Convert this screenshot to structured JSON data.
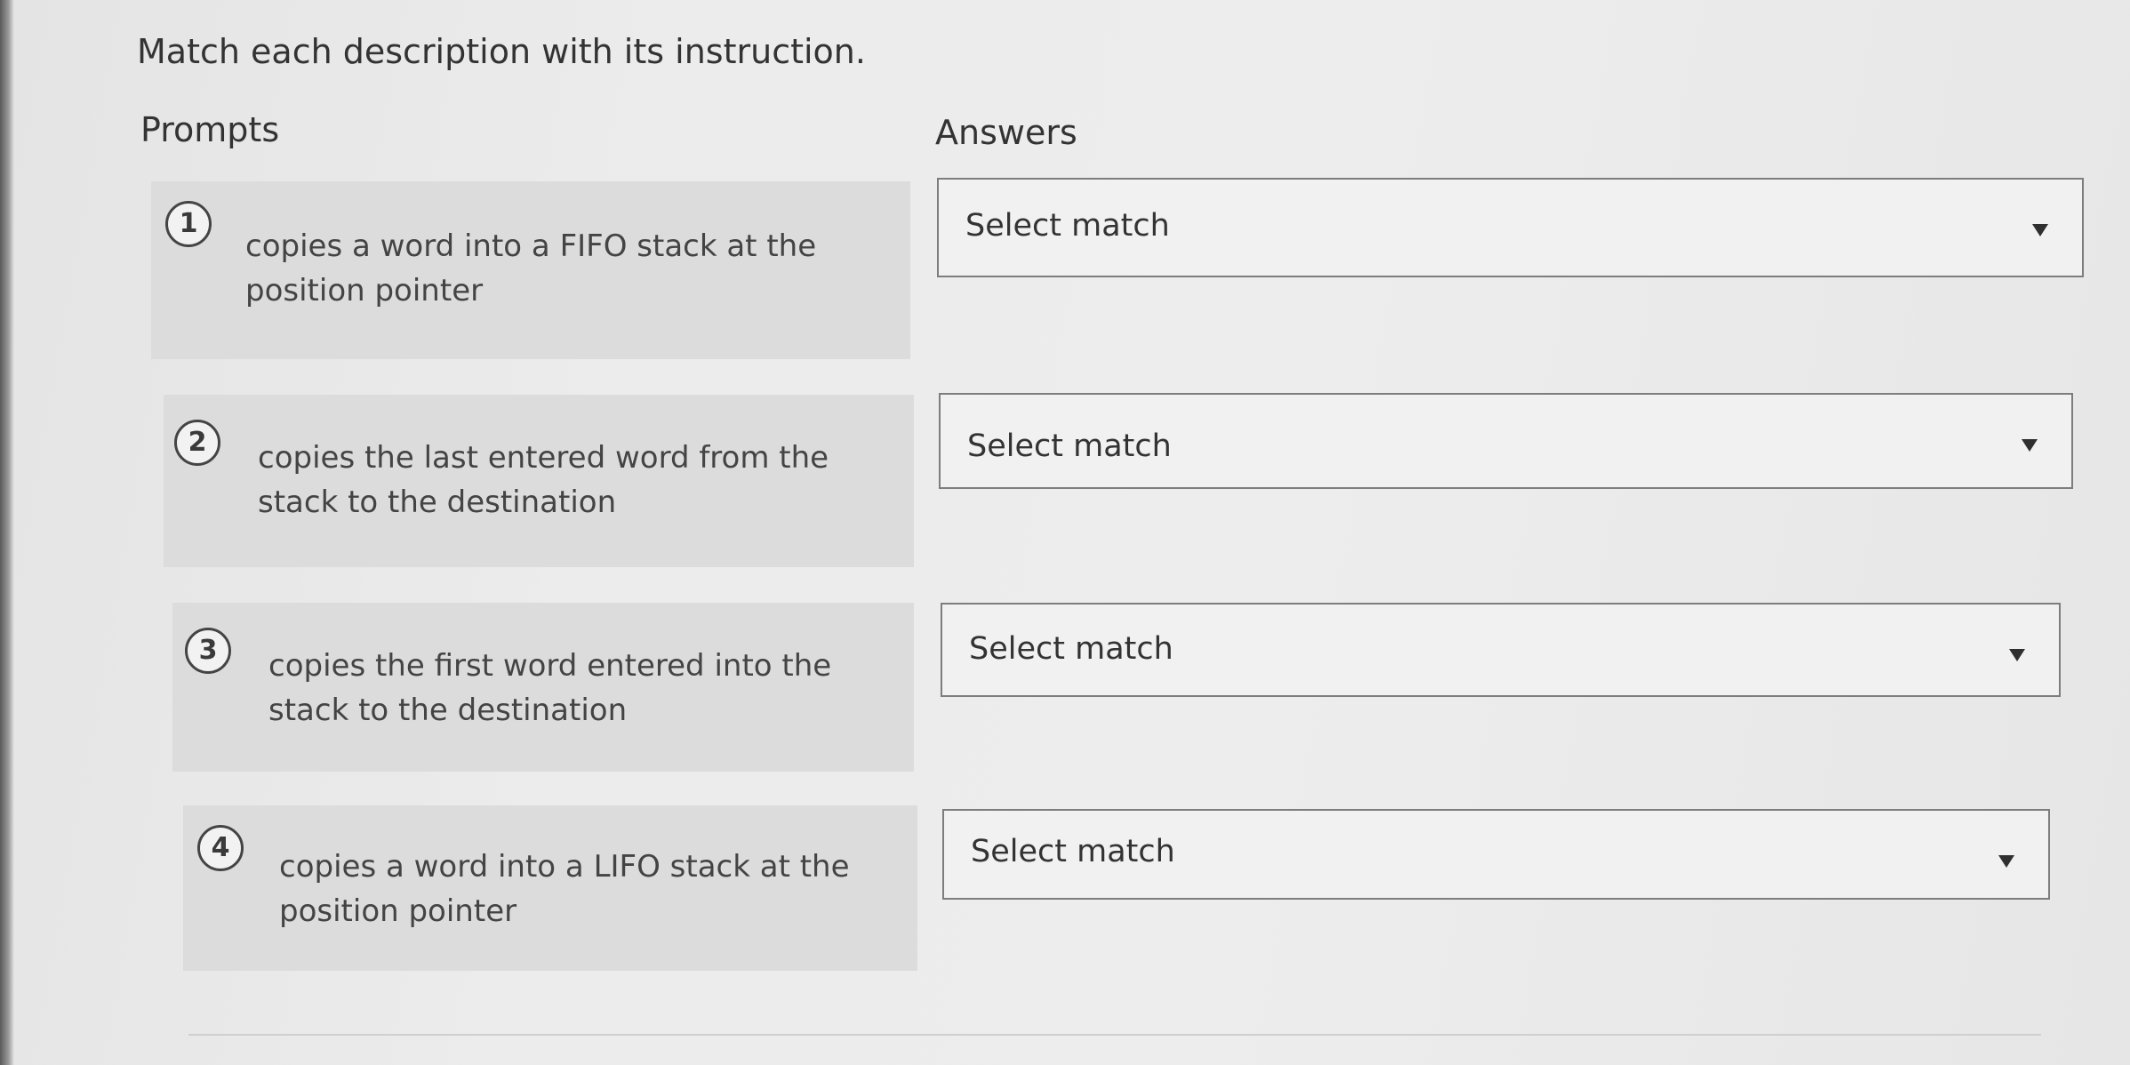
{
  "instruction": "Match each description with its instruction.",
  "columns": {
    "prompts_label": "Prompts",
    "answers_label": "Answers"
  },
  "prompts": [
    {
      "number": "1",
      "text": "copies a word into a FIFO stack at the position pointer"
    },
    {
      "number": "2",
      "text": "copies the last entered word from the stack to the destination"
    },
    {
      "number": "3",
      "text": "copies the first word entered into the stack to the destination"
    },
    {
      "number": "4",
      "text": "copies a word into a LIFO stack at the position pointer"
    }
  ],
  "answers": [
    {
      "selected": "Select match",
      "icon": "caret-down-icon"
    },
    {
      "selected": "Select match",
      "icon": "caret-down-icon"
    },
    {
      "selected": "Select match",
      "icon": "caret-down-icon"
    },
    {
      "selected": "Select match",
      "icon": "caret-down-icon"
    }
  ]
}
